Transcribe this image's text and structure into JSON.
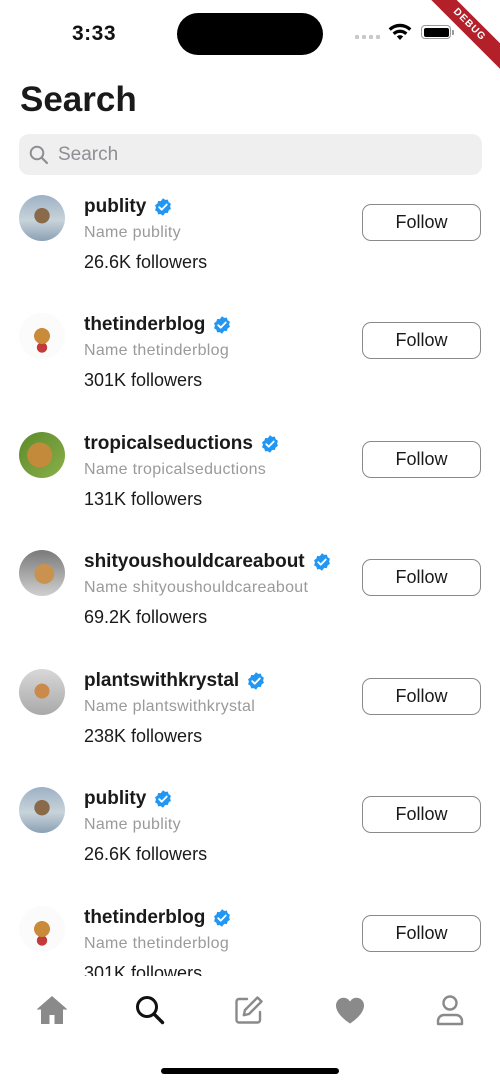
{
  "status_bar": {
    "time": "3:33",
    "debug_label": "DEBUG"
  },
  "header": {
    "title": "Search"
  },
  "search": {
    "placeholder": "Search",
    "value": ""
  },
  "users": [
    {
      "username": "publity",
      "subname": "Name publity",
      "followers": "26.6K followers",
      "follow_label": "Follow",
      "verified": true
    },
    {
      "username": "thetinderblog",
      "subname": "Name thetinderblog",
      "followers": "301K followers",
      "follow_label": "Follow",
      "verified": true
    },
    {
      "username": "tropicalseductions",
      "subname": "Name tropicalseductions",
      "followers": "131K followers",
      "follow_label": "Follow",
      "verified": true
    },
    {
      "username": "shityoushouldcareabout",
      "subname": "Name shityoushouldcareabout",
      "followers": "69.2K followers",
      "follow_label": "Follow",
      "verified": true
    },
    {
      "username": "plantswithkrystal",
      "subname": "Name plantswithkrystal",
      "followers": "238K followers",
      "follow_label": "Follow",
      "verified": true
    },
    {
      "username": "publity",
      "subname": "Name publity",
      "followers": "26.6K followers",
      "follow_label": "Follow",
      "verified": true
    },
    {
      "username": "thetinderblog",
      "subname": "Name thetinderblog",
      "followers": "301K followers",
      "follow_label": "Follow",
      "verified": true
    }
  ],
  "tab_bar": {
    "tabs": [
      {
        "icon": "home-icon",
        "active": false
      },
      {
        "icon": "search-icon",
        "active": true
      },
      {
        "icon": "edit-icon",
        "active": false
      },
      {
        "icon": "heart-icon",
        "active": false
      },
      {
        "icon": "profile-icon",
        "active": false
      }
    ]
  },
  "colors": {
    "verified": "#2196f3",
    "inactive_icon": "#8a8a8a",
    "active_icon": "#111111"
  }
}
